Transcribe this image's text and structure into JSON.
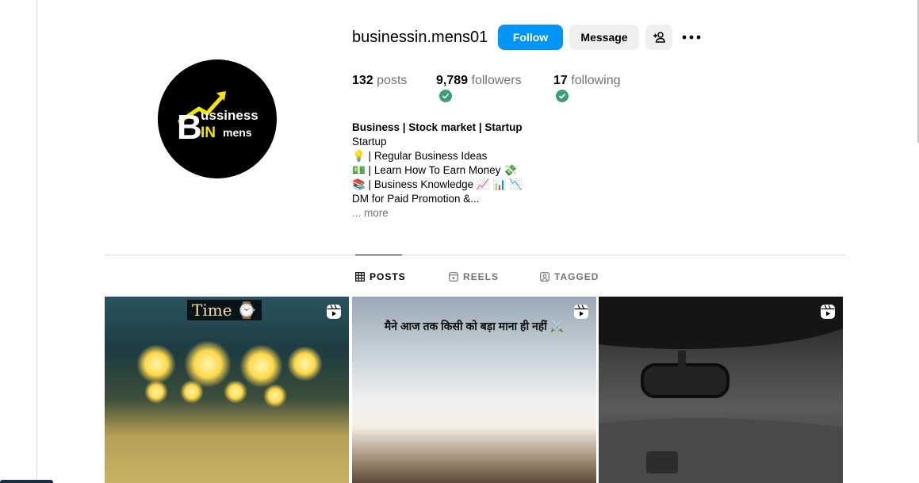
{
  "profile": {
    "username": "businessin.mens01",
    "avatar_text_top": "ussiness",
    "avatar_text_letter": "B",
    "avatar_text_bottom": "IN",
    "avatar_text_mens": "mens",
    "follow_label": "Follow",
    "message_label": "Message",
    "add_user_icon": "add-user-icon",
    "more_icon": "more-options-icon"
  },
  "stats": {
    "posts_count": "132",
    "posts_label": "posts",
    "followers_count": "9,789",
    "followers_label": "followers",
    "following_count": "17",
    "following_label": "following"
  },
  "bio": {
    "title": "Business | Stock market | Startup",
    "lines": [
      "Startup",
      "💡 | Regular Business Ideas",
      "💵 | Learn How To Earn Money 💸",
      "📚 | Business Knowledge 📈 📊 📉",
      "DM for Paid Promotion &..."
    ],
    "more_label": "... more"
  },
  "tabs": [
    {
      "label": "POSTS",
      "icon": "grid-icon",
      "active": true
    },
    {
      "label": "REELS",
      "icon": "reels-icon",
      "active": false
    },
    {
      "label": "TAGGED",
      "icon": "tagged-icon",
      "active": false
    }
  ],
  "posts": [
    {
      "caption": "Time ⌚",
      "type": "reel",
      "icon": "reel-icon"
    },
    {
      "caption": "मैने आज तक किसी को बड़ा माना ही नहीं ⚔️",
      "type": "reel",
      "icon": "reel-icon"
    },
    {
      "caption": "",
      "type": "reel",
      "icon": "reel-icon"
    }
  ],
  "colors": {
    "follow_button": "#0095f6",
    "secondary_button": "#efefef",
    "verified_check": "#3a9f74",
    "muted_text": "#737373",
    "avatar_accent": "#f5e400"
  }
}
